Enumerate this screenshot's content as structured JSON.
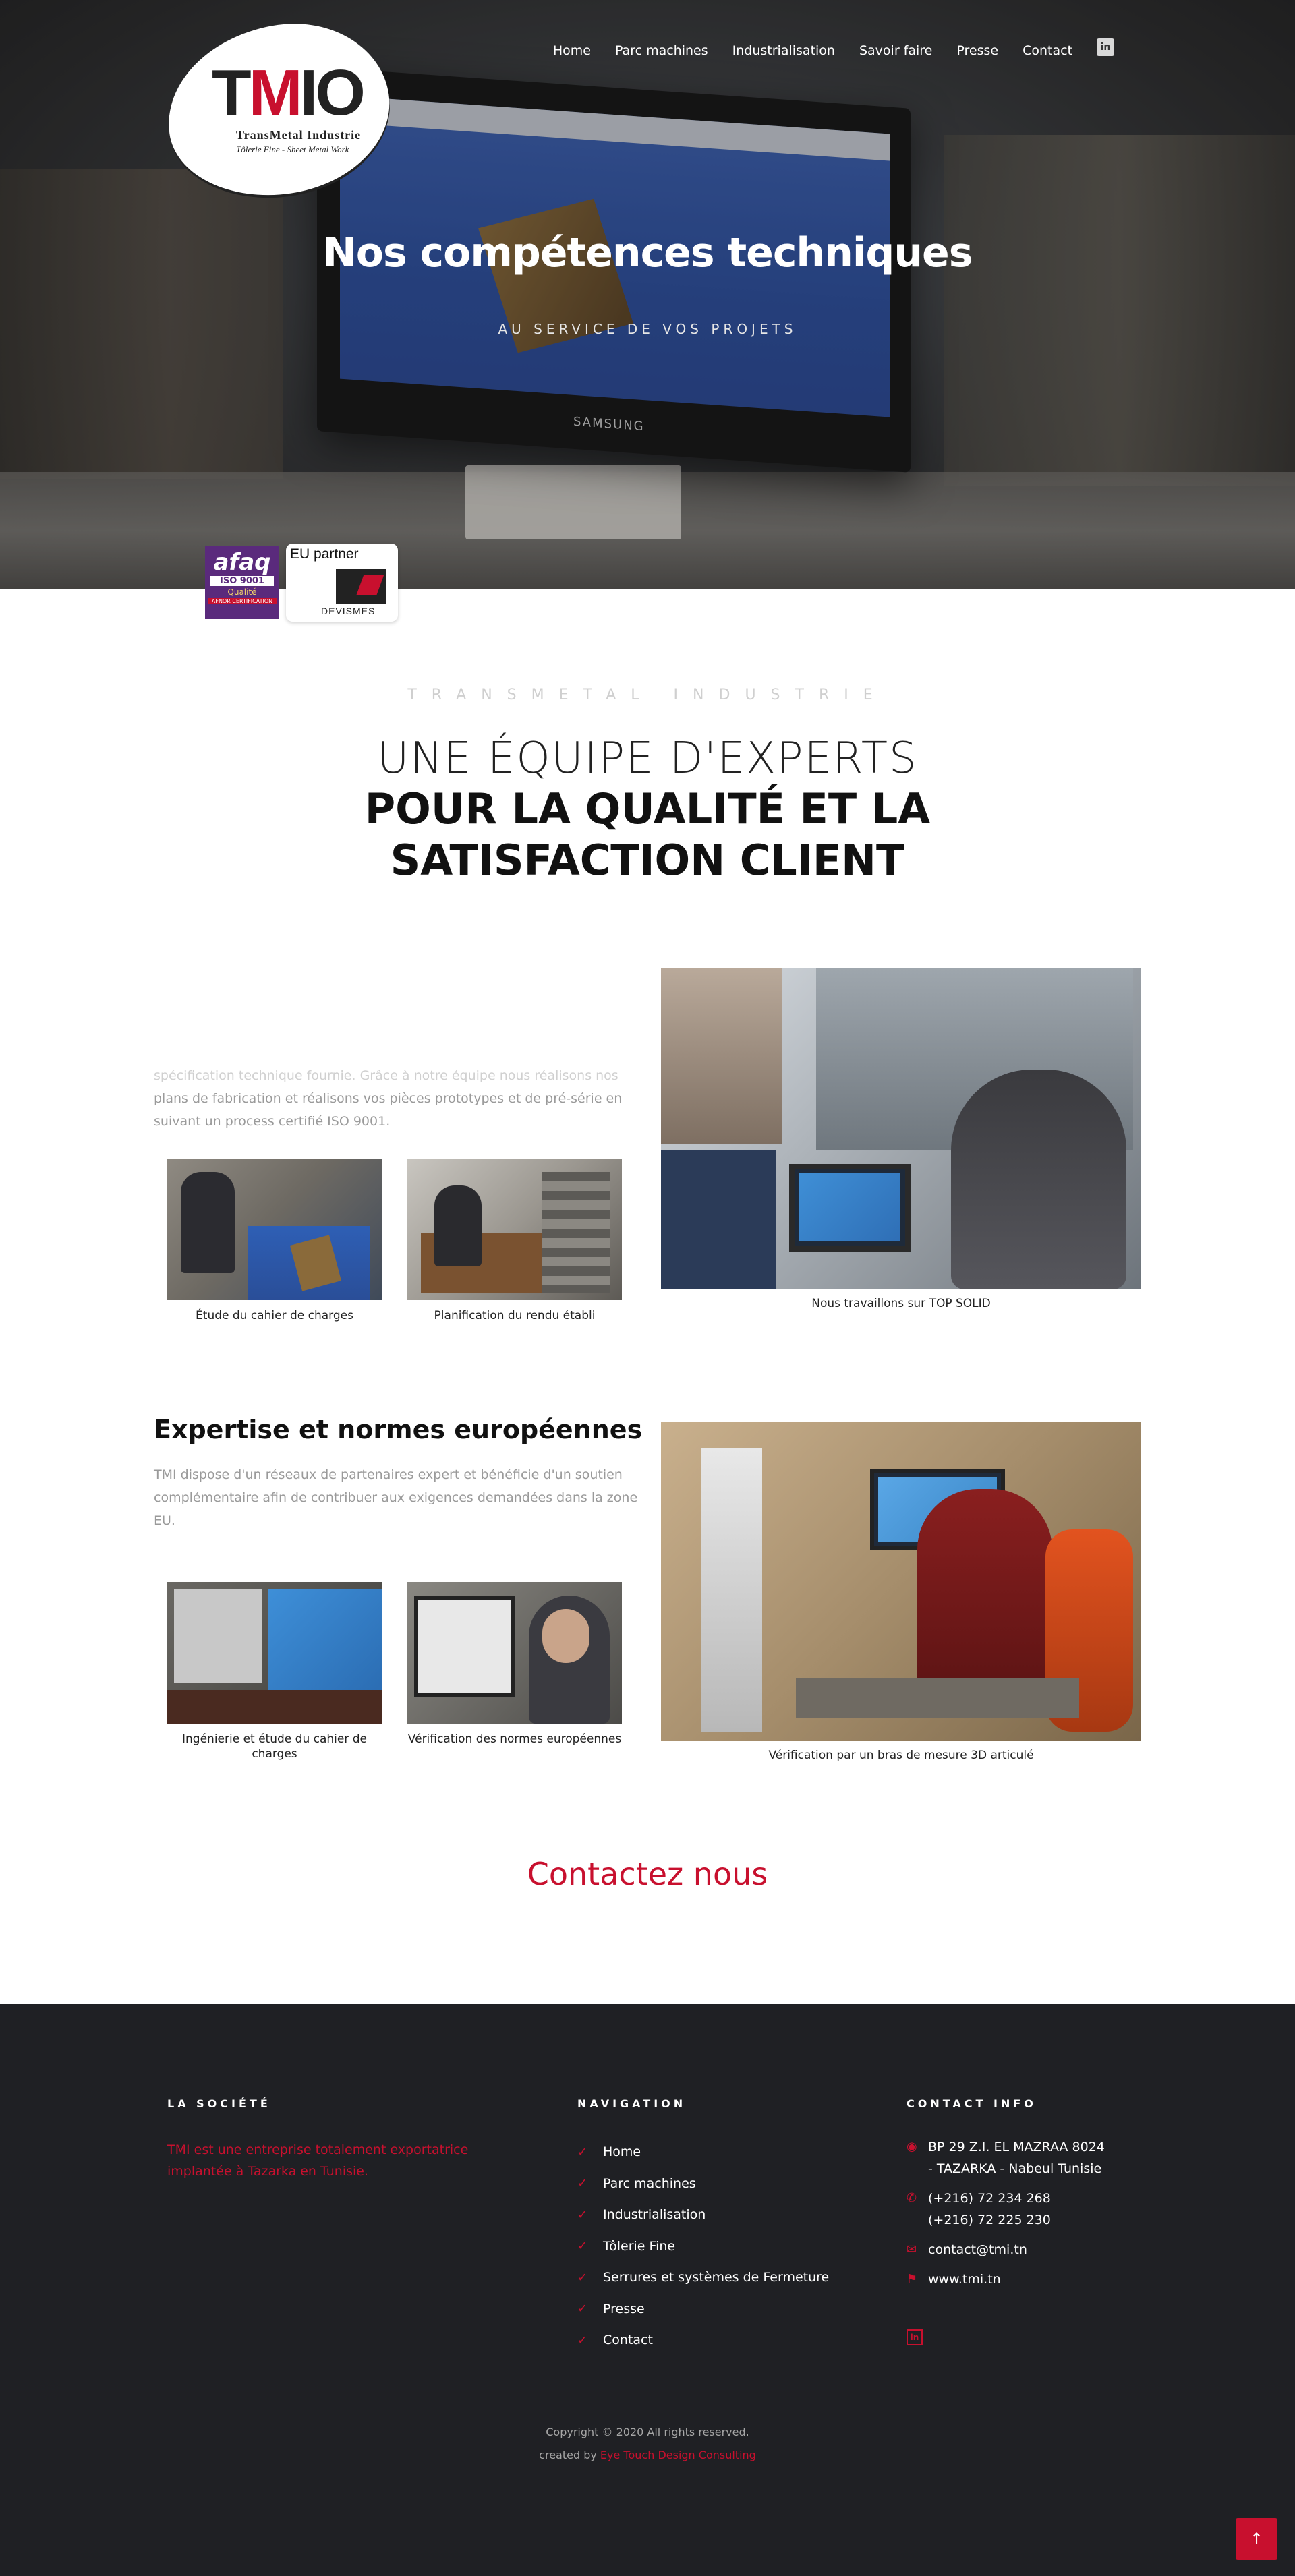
{
  "nav": {
    "items": [
      "Home",
      "Parc machines",
      "Industrialisation",
      "Savoir faire",
      "Presse",
      "Contact"
    ],
    "linkedin": "in"
  },
  "logo": {
    "mark_t": "T",
    "mark_m": "M",
    "mark_io": "IO",
    "name": "TransMetal Industrie",
    "tagline": "Tôlerie Fine - Sheet Metal Work"
  },
  "hero": {
    "title": "Nos compétences techniques",
    "subtitle": "AU SERVICE DE VOS PROJETS",
    "monitor_brand": "SAMSUNG"
  },
  "badges": {
    "afaq": "afaq",
    "iso": "ISO 9001",
    "qualite": "Qualité",
    "afnor": "AFNOR CERTIFICATION",
    "eu_partner": "EU partner",
    "devismes": "DEVISMES"
  },
  "intro": {
    "eyebrow": "TRANSMETAL INDUSTRIE",
    "heading_light": "UNE ÉQUIPE D'EXPERTS",
    "heading_bold": "POUR LA QUALITÉ ET LA SATISFACTION CLIENT"
  },
  "section1": {
    "text_faded": "spécification technique fournie. Grâce à notre équipe nous réalisons nos",
    "text": "plans de fabrication et réalisons vos pièces prototypes et de pré-série en suivant un process certifié ISO 9001.",
    "captions": [
      "Étude du cahier de charges",
      "Planification du rendu établi",
      "Nous travaillons sur TOP SOLID"
    ]
  },
  "section2": {
    "title": "Expertise et normes européennes",
    "text": "TMI dispose d'un réseaux de partenaires expert et bénéficie d'un soutien complémentaire afin de contribuer aux exigences demandées dans la zone EU.",
    "captions": [
      "Ingénierie et étude du cahier de charges",
      "Vérification des normes européennes",
      "Vérification par un bras de mesure 3D articulé"
    ]
  },
  "contact_cta": "Contactez nous",
  "footer": {
    "about_heading": "LA SOCIÉTÉ",
    "about_text": "TMI est une entreprise totalement exportatrice implantée à Tazarka en Tunisie.",
    "nav_heading": "NAVIGATION",
    "nav_items": [
      "Home",
      "Parc machines",
      "Industrialisation",
      "Tôlerie Fine",
      "Serrures et systèmes de Fermeture",
      "Presse",
      "Contact"
    ],
    "contact_heading": "CONTACT INFO",
    "address": "BP 29 Z.I. EL MAZRAA 8024 - TAZARKA - Nabeul Tunisie",
    "phone1": "(+216) 72 234 268",
    "phone2": "(+216) 72 225 230",
    "email": "contact@tmi.tn",
    "website": "www.tmi.tn",
    "linkedin": "in",
    "copyright": "Copyright © 2020 All rights reserved.",
    "created_by": "created by",
    "credit": "Eye Touch Design Consulting"
  },
  "back_to_top": "↑",
  "colors": {
    "accent": "#c8102e",
    "footer_bg": "#1f2024"
  }
}
